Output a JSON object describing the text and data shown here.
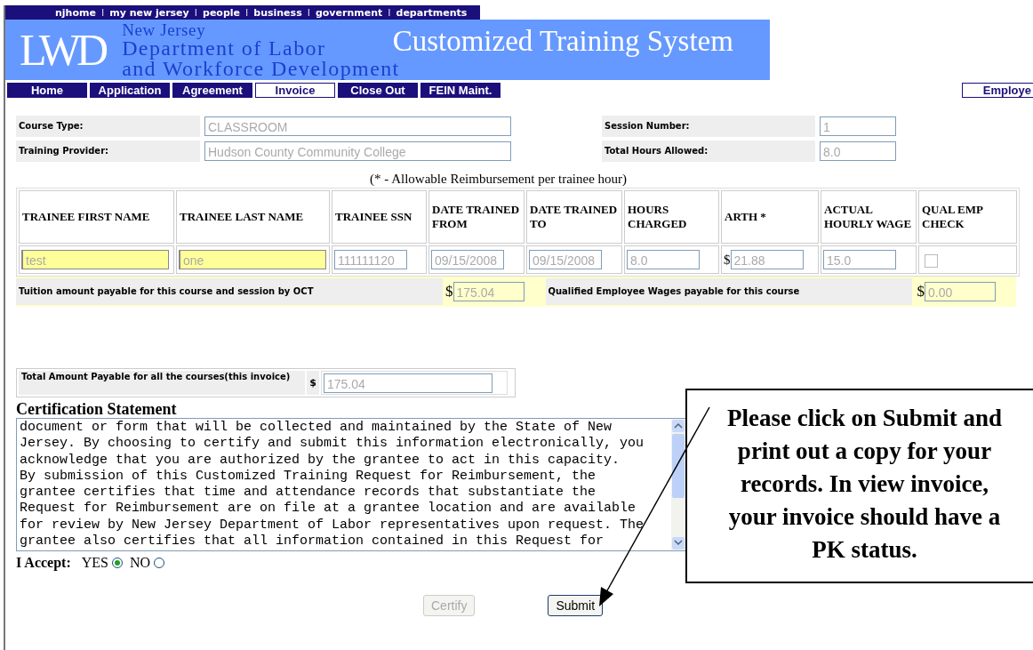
{
  "top_links": [
    {
      "kind": "link",
      "text": "njhome"
    },
    {
      "kind": "separator",
      "text": "I"
    },
    {
      "kind": "link",
      "text": "my new jersey"
    },
    {
      "kind": "separator",
      "text": "I"
    },
    {
      "kind": "link",
      "text": "people"
    },
    {
      "kind": "separator",
      "text": "I"
    },
    {
      "kind": "link",
      "text": "business"
    },
    {
      "kind": "separator",
      "text": "I"
    },
    {
      "kind": "link",
      "text": "government"
    },
    {
      "kind": "separator",
      "text": "I"
    },
    {
      "kind": "link",
      "text": "departments"
    }
  ],
  "banner": {
    "logo": "LWD",
    "agency_lines": [
      "New Jersey",
      "Department of Labor",
      "and Workforce Development"
    ],
    "title": "Customized Training System"
  },
  "nav_tabs": [
    {
      "label": "Home",
      "selected": false
    },
    {
      "label": "Application",
      "selected": false
    },
    {
      "label": "Agreement",
      "selected": false
    },
    {
      "label": "Invoice",
      "selected": true
    },
    {
      "label": "Close Out",
      "selected": false
    },
    {
      "label": "FEIN Maint.",
      "selected": false
    }
  ],
  "employee_tab": {
    "label": "Employe"
  },
  "course_info": [
    [
      {
        "label": "Course Type:",
        "value": "CLASSROOM"
      },
      {
        "label": "Session Number:",
        "value": "1"
      }
    ],
    [
      {
        "label": "Training Provider:",
        "value": "Hudson County Community College"
      },
      {
        "label": "Total Hours Allowed:",
        "value": "8.0"
      }
    ]
  ],
  "note": "(* - Allowable Reimbursement per trainee hour)",
  "trainee_table": {
    "columns": [
      "TRAINEE FIRST NAME",
      "TRAINEE LAST NAME",
      "TRAINEE SSN",
      "DATE TRAINED FROM",
      "DATE TRAINED TO",
      "HOURS CHARGED",
      "ARTH *",
      "ACTUAL HOURLY WAGE",
      "QUAL EMP CHECK"
    ],
    "rows": [
      {
        "cells": [
          {
            "kind": "field",
            "value": "test",
            "highlighted": true
          },
          {
            "kind": "field",
            "value": "one",
            "highlighted": true
          },
          {
            "kind": "field",
            "value": "111111120",
            "highlighted": false
          },
          {
            "kind": "field",
            "value": "09/15/2008",
            "highlighted": false
          },
          {
            "kind": "field",
            "value": "09/15/2008",
            "highlighted": false
          },
          {
            "kind": "field",
            "value": "8.0",
            "highlighted": false
          },
          {
            "kind": "field",
            "prefix": "$",
            "value": "21.88",
            "highlighted": false
          },
          {
            "kind": "field",
            "value": "15.0",
            "highlighted": false
          },
          {
            "kind": "checkbox",
            "checked": false
          }
        ]
      }
    ]
  },
  "tuition": {
    "label": "Tuition amount payable for this course and session by OCT",
    "prefix": "$",
    "value": "175.04"
  },
  "qualified_wages": {
    "label": "Qualified Employee Wages payable for this course",
    "prefix": "$",
    "value": "0.00"
  },
  "total": {
    "label": "Total Amount Payable for all the courses(this invoice)",
    "prefix": "$",
    "value": "175.04"
  },
  "certification": {
    "heading": "Certification Statement",
    "text": "document or form that will be collected and maintained by the State of New\nJersey. By choosing to certify and submit this information electronically, you\nacknowledge that you are authorized by the grantee to act in this capacity.\nBy submission of this Customized Training Request for Reimbursement, the\ngrantee certifies that time and attendance records that substantiate the\nRequest for Reimbursement are on file at a grantee location and are available\nfor review by New Jersey Department of Labor representatives upon request. The\ngrantee also certifies that all information contained in this Request for"
  },
  "accept": {
    "label": "I Accept:",
    "options": [
      {
        "label": "YES",
        "selected": true
      },
      {
        "label": "NO",
        "selected": false
      }
    ]
  },
  "buttons": [
    {
      "label": "Certify",
      "disabled": true
    },
    {
      "label": "Submit",
      "disabled": false
    }
  ],
  "callout": {
    "text": "Please click on Submit and print out a copy for your records. In view invoice, your invoice should have a PK status."
  }
}
